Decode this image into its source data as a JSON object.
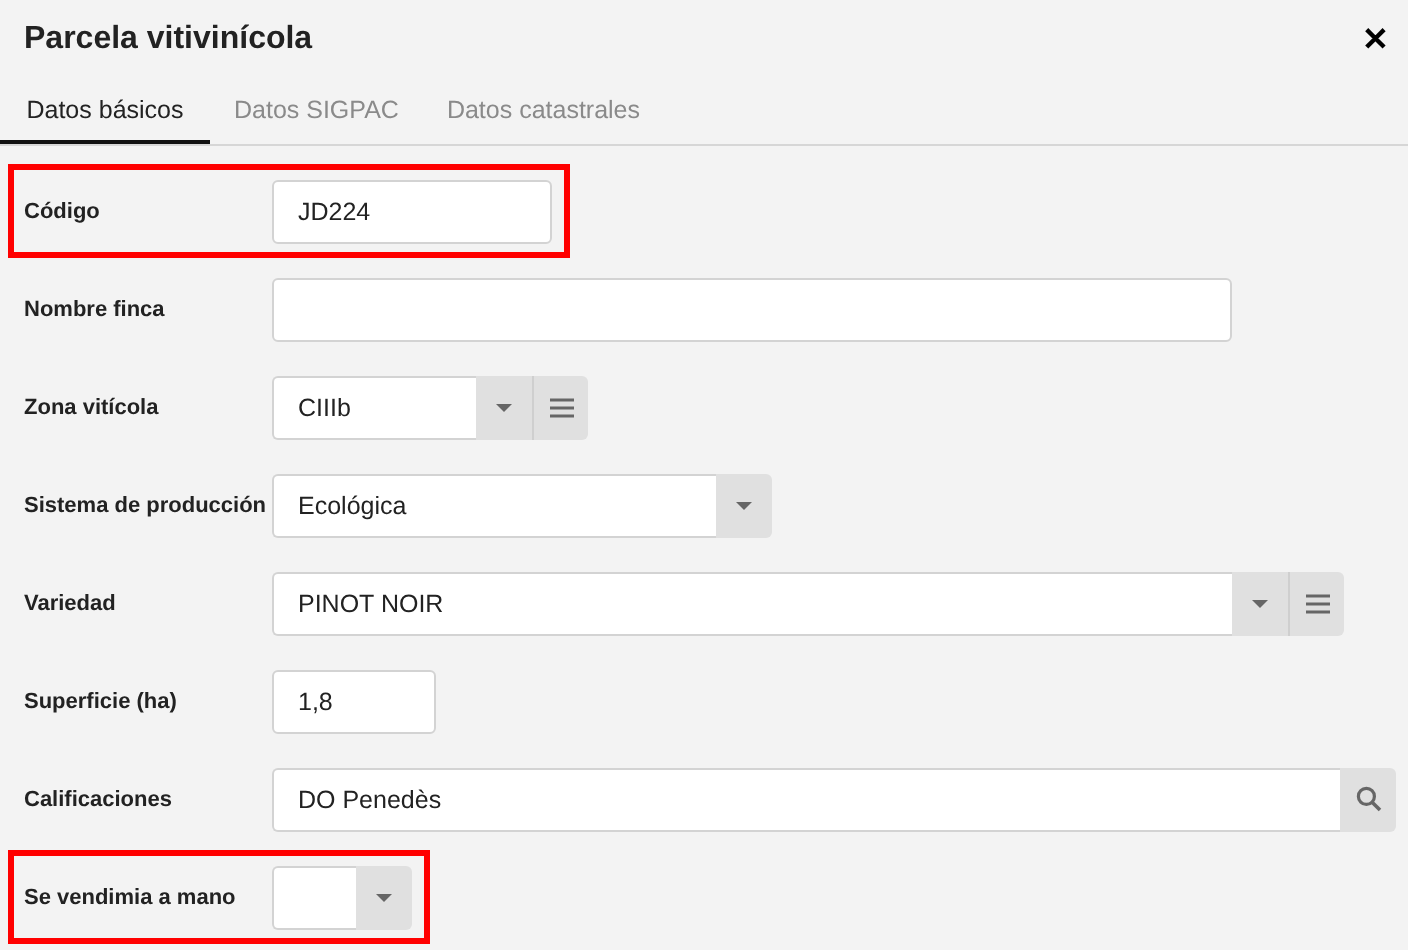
{
  "window": {
    "title": "Parcela vitivinícola",
    "close": "✕"
  },
  "tabs": [
    {
      "label": "Datos básicos",
      "selected": true
    },
    {
      "label": "Datos SIGPAC",
      "selected": false
    },
    {
      "label": "Datos catastrales",
      "selected": false
    }
  ],
  "fields": [
    {
      "label": "Código",
      "kind": "text",
      "value": "JD224",
      "highlighted": true
    },
    {
      "label": "Nombre finca",
      "kind": "text",
      "highlighted": false
    },
    {
      "label": "Zona vitícola",
      "kind": "select_menu",
      "value": "CIIIb",
      "highlighted": false
    },
    {
      "label": "Sistema de producción",
      "kind": "select",
      "value": "Ecológica",
      "highlighted": false
    },
    {
      "label": "Variedad",
      "kind": "select_menu",
      "value": "PINOT NOIR",
      "highlighted": false
    },
    {
      "label": "Superficie (ha)",
      "kind": "text",
      "value": "1,8",
      "highlighted": false
    },
    {
      "label": "Calificaciones",
      "kind": "search",
      "value": "DO Penedès",
      "highlighted": false
    },
    {
      "label": "Se vendimia a mano",
      "kind": "select",
      "highlighted": true
    }
  ]
}
